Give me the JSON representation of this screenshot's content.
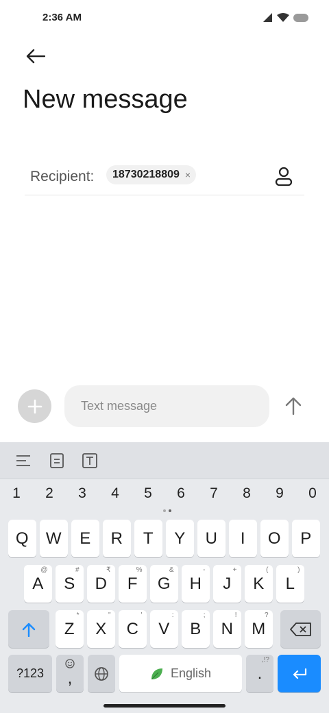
{
  "status_bar": {
    "time": "2:36 AM"
  },
  "header": {
    "title": "New message"
  },
  "recipient": {
    "label": "Recipient:",
    "chip_text": "18730218809",
    "chip_close": "×"
  },
  "composer": {
    "placeholder": "Text message"
  },
  "keyboard": {
    "number_row": [
      "1",
      "2",
      "3",
      "4",
      "5",
      "6",
      "7",
      "8",
      "9",
      "0"
    ],
    "row1": [
      {
        "label": "Q"
      },
      {
        "label": "W"
      },
      {
        "label": "E"
      },
      {
        "label": "R"
      },
      {
        "label": "T"
      },
      {
        "label": "Y"
      },
      {
        "label": "U"
      },
      {
        "label": "I"
      },
      {
        "label": "O"
      },
      {
        "label": "P"
      }
    ],
    "row2": [
      {
        "label": "A",
        "hint": "@"
      },
      {
        "label": "S",
        "hint": "#"
      },
      {
        "label": "D",
        "hint": "₹"
      },
      {
        "label": "F",
        "hint": "%"
      },
      {
        "label": "G",
        "hint": "&"
      },
      {
        "label": "H",
        "hint": "-"
      },
      {
        "label": "J",
        "hint": "+"
      },
      {
        "label": "K",
        "hint": "("
      },
      {
        "label": "L",
        "hint": ")"
      }
    ],
    "row3": [
      {
        "label": "Z",
        "hint": "*"
      },
      {
        "label": "X",
        "hint": "\""
      },
      {
        "label": "C",
        "hint": "'"
      },
      {
        "label": "V",
        "hint": ":"
      },
      {
        "label": "B",
        "hint": ";"
      },
      {
        "label": "N",
        "hint": "!"
      },
      {
        "label": "M",
        "hint": "?"
      }
    ],
    "symbols_label": "?123",
    "comma_label": ",",
    "space_label": "English",
    "period_label": ".",
    "period_hint": ",!?"
  },
  "colors": {
    "enter_key": "#1a8cff",
    "shift_arrow": "#1a8cff",
    "leaf": "#4caf50"
  },
  "icons": [
    "back-arrow-icon",
    "signal-icon",
    "wifi-icon",
    "battery-icon",
    "contact-icon",
    "plus-icon",
    "send-arrow-icon",
    "align-icon",
    "clipboard-icon",
    "text-format-icon",
    "shift-icon",
    "backspace-icon",
    "emoji-icon",
    "globe-icon",
    "leaf-icon",
    "enter-icon"
  ]
}
